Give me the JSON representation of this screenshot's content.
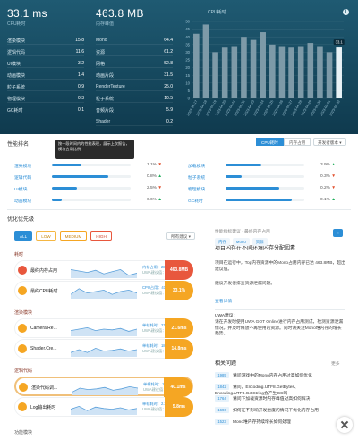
{
  "header": {
    "cpu_value": "33.1 ms",
    "cpu_label": "CPU耗时",
    "mem_value": "463.8 MB",
    "mem_label": "内存峰值",
    "left_stats": [
      {
        "label": "渲染模块",
        "value": "15.8"
      },
      {
        "label": "逻辑代码",
        "value": "11.6"
      },
      {
        "label": "UI模块",
        "value": "3.2"
      },
      {
        "label": "动画模块",
        "value": "1.4"
      },
      {
        "label": "粒子系统",
        "value": "0.9"
      },
      {
        "label": "物理模块",
        "value": "0.3"
      },
      {
        "label": "GC耗时",
        "value": "0.1"
      }
    ],
    "right_stats": [
      {
        "label": "Mono",
        "value": "64.4"
      },
      {
        "label": "资源",
        "value": "61.2"
      },
      {
        "label": "网格",
        "value": "52.8"
      },
      {
        "label": "动画片段",
        "value": "31.5"
      },
      {
        "label": "RenderTexture",
        "value": "25.0"
      },
      {
        "label": "粒子系统",
        "value": "10.5"
      },
      {
        "label": "音频片段",
        "value": "5.9"
      },
      {
        "label": "Shader",
        "value": "0.2"
      }
    ],
    "cpu_chart_title": "CPU耗时",
    "info_icon": "i"
  },
  "chart_data": {
    "type": "bar",
    "title": "CPU耗时",
    "categories": [
      "2023-04-17",
      "2023-04-18",
      "2023-04-19",
      "2023-04-20",
      "2023-04-21",
      "2023-04-22",
      "2023-04-23",
      "2023-04-24",
      "2023-04-25",
      "2023-04-26",
      "2023-04-27",
      "2023-04-28",
      "2023-04-29",
      "2023-04-30",
      "2023-05-01",
      "2023-05-02"
    ],
    "values": [
      42,
      48,
      30,
      33,
      34,
      40,
      38,
      43,
      35,
      34,
      33,
      34,
      36,
      34,
      30,
      33.1
    ],
    "ylim": [
      0,
      50
    ],
    "yticks": [
      0,
      5,
      10,
      15,
      20,
      25,
      30,
      35,
      40,
      45,
      50
    ],
    "highlight_index": 15,
    "highlight_label": "33.1"
  },
  "module_section": {
    "title": "性能排名",
    "tooltip": "按一段时间内的性能表现，展示上次报告，模块占用比例",
    "tab_cpu": "CPU耗时",
    "tab_mem": "内存占用",
    "dropdown": "开发者版本",
    "left_rows": [
      {
        "name": "渲染模块",
        "fill": 0.38,
        "pct": "1.1%",
        "arrow": "▼",
        "up": false
      },
      {
        "name": "逻辑代码",
        "fill": 0.72,
        "pct": "0.8%",
        "arrow": "▲",
        "up": true
      },
      {
        "name": "UI模块",
        "fill": 0.32,
        "pct": "2.5%",
        "arrow": "▼",
        "up": false
      },
      {
        "name": "动画模块",
        "fill": 0.12,
        "pct": "6.6%",
        "arrow": "▲",
        "up": true
      }
    ],
    "right_rows": [
      {
        "name": "加载模块",
        "fill": 0.45,
        "pct": "3.9%",
        "arrow": "▲",
        "up": true
      },
      {
        "name": "粒子系统",
        "fill": 0.2,
        "pct": "0.3%",
        "arrow": "▼",
        "up": false
      },
      {
        "name": "物理模块",
        "fill": 0.68,
        "pct": "0.2%",
        "arrow": "▼",
        "up": false
      },
      {
        "name": "GC耗时",
        "fill": 0.84,
        "pct": "0.1%",
        "arrow": "▲",
        "up": true
      }
    ]
  },
  "issues": {
    "title": "优化优先级",
    "filters": [
      "ALL",
      "LOW",
      "MEDIUM",
      "HIGH"
    ],
    "dropdown": "所有建议",
    "groups": [
      {
        "title": "耗时"
      },
      {
        "title": "渲染模块"
      },
      {
        "title": "逻辑代码"
      }
    ],
    "cards": [
      {
        "name": "最终内存占用",
        "m1": "内存占用：287.3",
        "m2": "UWA建议值：1x",
        "badge": "463.8MB",
        "color": "#e8573d",
        "sparkline": [
          0.6,
          0.5,
          0.4,
          0.55,
          0.3,
          0.45,
          0.6,
          0.2,
          0.35
        ]
      },
      {
        "name": "最终CPU耗时",
        "m1": "CPU占用：41.5%",
        "m2": "UWA建议值：40%",
        "badge": "33.1%",
        "color": "#f5a623",
        "sparkline": [
          0.3,
          0.7,
          0.4,
          0.5,
          0.6,
          0.3,
          0.5,
          0.6,
          0.4
        ]
      },
      {
        "name": "Camera.Re...",
        "m1": "单帧耗时：27.4",
        "m2": "UWA建议值：1x",
        "badge": "21.6ms",
        "color": "#f5a623",
        "sparkline": [
          0.4,
          0.5,
          0.6,
          0.4,
          0.5,
          0.45,
          0.55,
          0.35,
          0.5
        ]
      },
      {
        "name": "Shader.Cre...",
        "m1": "单帧耗时：18.6",
        "m2": "UWA建议值：1x",
        "badge": "14.8ms",
        "color": "#f5a623",
        "sparkline": [
          0.3,
          0.5,
          0.3,
          0.6,
          0.4,
          0.45,
          0.55,
          0.4,
          0.5
        ]
      },
      {
        "name": "渲染代码调...",
        "m1": "单帧耗时：118.2",
        "m2": "UWA建议值：50",
        "badge": "40.1ms",
        "color": "#f5a623",
        "sparkline": [
          0.2,
          0.5,
          0.4,
          0.45,
          0.55,
          0.35,
          0.45,
          0.6,
          0.5
        ]
      },
      {
        "name": "Log输出耗时",
        "m1": "单帧耗时：2.2",
        "m2": "UWA建议值：1x",
        "badge": "5.8ms",
        "color": "#f5a623",
        "sparkline": [
          0.4,
          0.6,
          0.3,
          0.55,
          0.45,
          0.4,
          0.5,
          0.35,
          0.45
        ]
      }
    ],
    "more": "功能模块"
  },
  "detail": {
    "breadcrumb": "性能指标建议 · 最终内存占用",
    "title": "项目内存在不同环境内存分配因素",
    "tags": [
      "内存",
      "Mono",
      "资源"
    ],
    "paragraph1": "项目在运行中，Top内存资源中的Mono占用内存已达 463.8MB，超出建议值。",
    "paragraph2": "建议开发者排查资源泄漏问题。",
    "link": "查看详情",
    "mini_title": "UWA建议：",
    "paragraph3": "请在开发时使用UWA GOT Online进行内存占用测试，检测资源泄漏情况，并及时释放不再使用的资源。同时请关注Mono堆内存的增长趋势。",
    "related_title": "相关问题",
    "related_more": "更多",
    "related": [
      {
        "num": "1985",
        "text": "请问游戏中的Mono内存占用过高如何优化"
      },
      {
        "num": "1842",
        "text": "请问，Encoding.UTF8.GetBytes、Encoding.UTF8.GetString会产生GC吗"
      },
      {
        "num": "1764",
        "text": "请问下加载资源时内存峰值过高如何解决"
      },
      {
        "num": "1696",
        "text": "如何在不影响开发进度的情况下优化内存占用"
      },
      {
        "num": "1523",
        "text": "Mono堆内存持续增长如何处理"
      }
    ]
  }
}
